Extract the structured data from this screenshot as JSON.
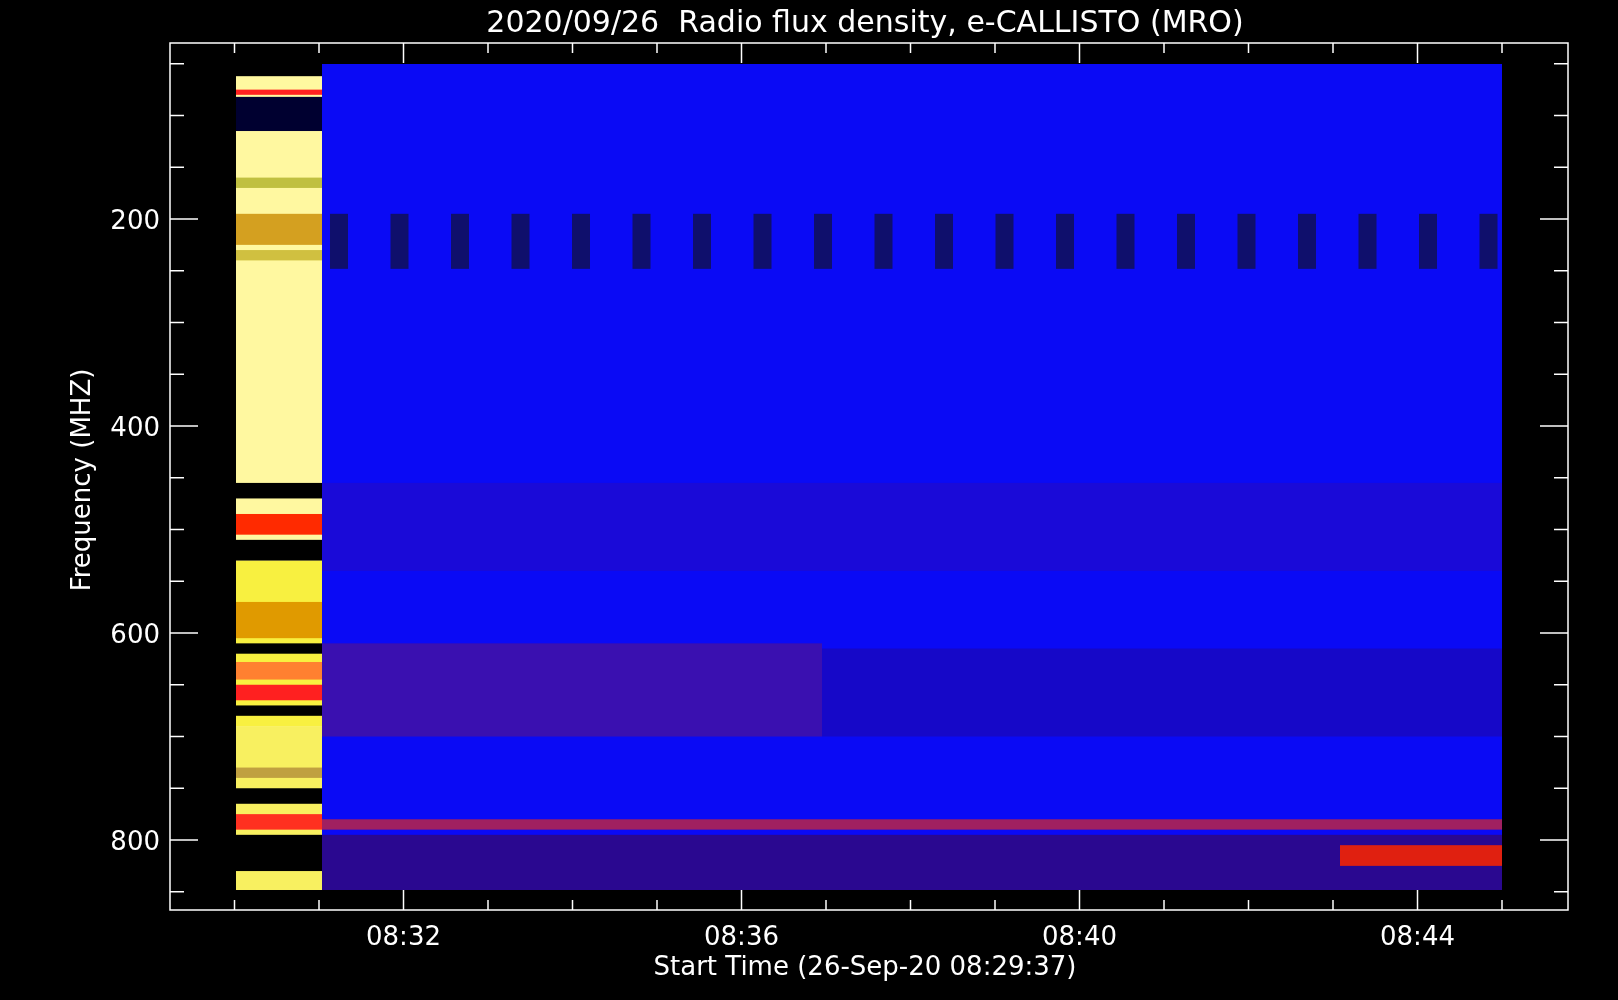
{
  "title": "2020/09/26  Radio flux density, e-CALLISTO (MRO)",
  "y_axis": {
    "label": "Frequency (MHZ)",
    "ticks": [
      "200",
      "400",
      "600",
      "800"
    ]
  },
  "x_axis": {
    "label": "Start Time (26-Sep-20 08:29:37)",
    "ticks": [
      "08:32",
      "08:36",
      "08:40",
      "08:44"
    ]
  }
}
